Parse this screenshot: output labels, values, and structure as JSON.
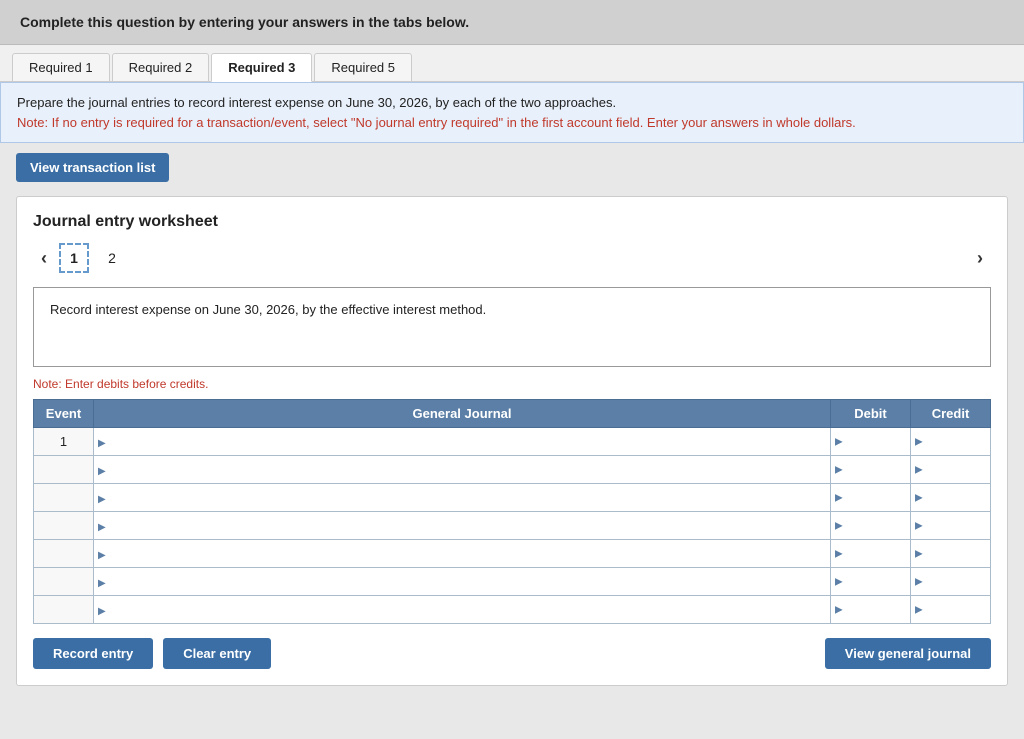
{
  "banner": {
    "text": "Complete this question by entering your answers in the tabs below."
  },
  "tabs": [
    {
      "id": "required-1",
      "label": "Required 1",
      "active": false
    },
    {
      "id": "required-2",
      "label": "Required 2",
      "active": false
    },
    {
      "id": "required-3",
      "label": "Required 3",
      "active": true
    },
    {
      "id": "required-5",
      "label": "Required 5",
      "active": false
    }
  ],
  "instructions": {
    "main_text": "Prepare the journal entries to record interest expense on June 30, 2026, by each of the two approaches.",
    "note_text": "Note: If no entry is required for a transaction/event, select \"No journal entry required\" in the first account field. Enter your answers in whole dollars."
  },
  "view_transaction_btn": "View transaction list",
  "worksheet": {
    "title": "Journal entry worksheet",
    "current_page": "1",
    "page_2": "2",
    "description": "Record interest expense on June 30, 2026, by the effective interest method.",
    "note_debits": "Note: Enter debits before credits.",
    "table": {
      "headers": [
        "Event",
        "General Journal",
        "Debit",
        "Credit"
      ],
      "rows": [
        {
          "event": "1",
          "general_journal": "",
          "debit": "",
          "credit": ""
        },
        {
          "event": "",
          "general_journal": "",
          "debit": "",
          "credit": ""
        },
        {
          "event": "",
          "general_journal": "",
          "debit": "",
          "credit": ""
        },
        {
          "event": "",
          "general_journal": "",
          "debit": "",
          "credit": ""
        },
        {
          "event": "",
          "general_journal": "",
          "debit": "",
          "credit": ""
        },
        {
          "event": "",
          "general_journal": "",
          "debit": "",
          "credit": ""
        },
        {
          "event": "",
          "general_journal": "",
          "debit": "",
          "credit": ""
        }
      ]
    },
    "buttons": {
      "record_entry": "Record entry",
      "clear_entry": "Clear entry",
      "view_general_journal": "View general journal"
    }
  }
}
